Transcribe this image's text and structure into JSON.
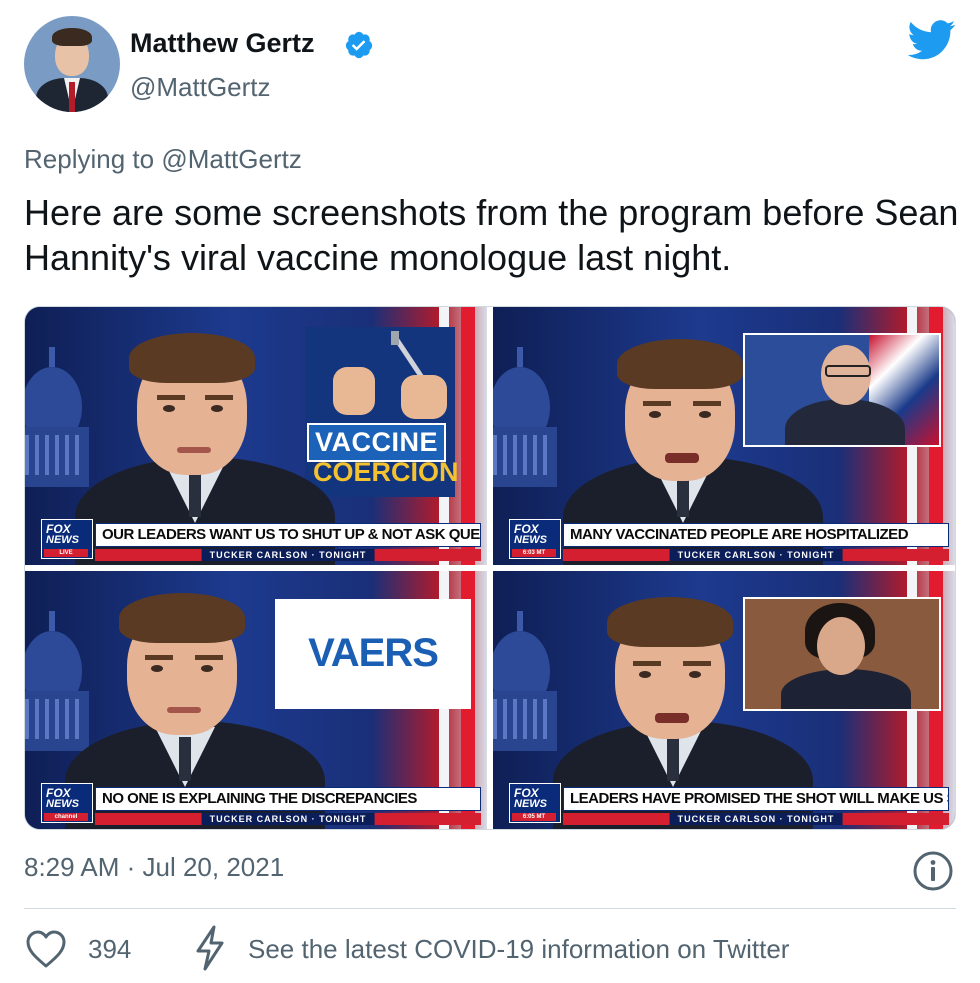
{
  "author": {
    "name": "Matthew Gertz",
    "handle": "@MattGertz",
    "verified": true
  },
  "reply": {
    "prefix": "Replying to",
    "mention": "@MattGertz"
  },
  "tweet": {
    "text": "Here are some screenshots from the program before Sean Hannity's viral vaccine monologue last night."
  },
  "media": {
    "panels": [
      {
        "headline": "OUR LEADERS WANT US TO SHUT UP & NOT ASK QUESTIONS",
        "show": "TUCKER CARLSON · TONIGHT",
        "network": "FOX NEWS",
        "tag": "LIVE",
        "graphic_line1": "VACCINE",
        "graphic_line2": "COERCION"
      },
      {
        "headline": "MANY VACCINATED PEOPLE ARE HOSPITALIZED",
        "show": "TUCKER CARLSON · TONIGHT",
        "network": "FOX NEWS",
        "tag": "6:03 MT"
      },
      {
        "headline": "NO ONE IS EXPLAINING THE DISCREPANCIES",
        "show": "TUCKER CARLSON · TONIGHT",
        "network": "FOX NEWS",
        "tag": "channel",
        "graphic_line1": "VAERS"
      },
      {
        "headline": "LEADERS HAVE PROMISED THE SHOT WILL MAKE US SAFE",
        "show": "TUCKER CARLSON · TONIGHT",
        "network": "FOX NEWS",
        "tag": "6:05 MT"
      }
    ]
  },
  "meta": {
    "time": "8:29 AM · Jul 20, 2021"
  },
  "actions": {
    "likes": "394",
    "covid_info": "See the latest COVID-19 information on Twitter"
  },
  "icons": {
    "twitter": "twitter-bird-icon",
    "verified": "verified-badge-icon",
    "info": "info-icon",
    "like": "heart-icon",
    "covid": "lightning-bolt-icon"
  },
  "colors": {
    "twitter_blue": "#1d9bf0",
    "secondary_text": "#536471",
    "fox_red": "#d31f2f",
    "fox_navy": "#0a2a7a"
  }
}
